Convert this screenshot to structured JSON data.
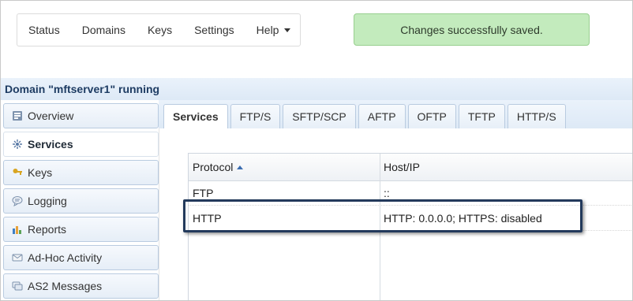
{
  "topnav": {
    "items": [
      "Status",
      "Domains",
      "Keys",
      "Settings",
      "Help"
    ]
  },
  "alert": {
    "text": "Changes successfully saved."
  },
  "domain": {
    "title": "Domain \"mftserver1\" running"
  },
  "sidebar": {
    "items": [
      {
        "label": "Overview",
        "icon": "overview-icon"
      },
      {
        "label": "Services",
        "icon": "services-icon"
      },
      {
        "label": "Keys",
        "icon": "keys-icon"
      },
      {
        "label": "Logging",
        "icon": "logging-icon"
      },
      {
        "label": "Reports",
        "icon": "reports-icon"
      },
      {
        "label": "Ad-Hoc Activity",
        "icon": "adhoc-icon"
      },
      {
        "label": "AS2 Messages",
        "icon": "as2-icon"
      }
    ],
    "active": "Services"
  },
  "tabs": {
    "items": [
      "Services",
      "FTP/S",
      "SFTP/SCP",
      "AFTP",
      "OFTP",
      "TFTP",
      "HTTP/S"
    ],
    "active": "Services"
  },
  "grid": {
    "columns": {
      "protocol": "Protocol",
      "host": "Host/IP"
    },
    "rows": [
      {
        "protocol": "FTP",
        "host": "::"
      },
      {
        "protocol": "HTTP",
        "host": "HTTP: 0.0.0.0; HTTPS: disabled"
      }
    ]
  },
  "colors": {
    "accent": "#1e3c63",
    "alert_bg": "#c3ebbd",
    "highlight": "#233a5c"
  }
}
